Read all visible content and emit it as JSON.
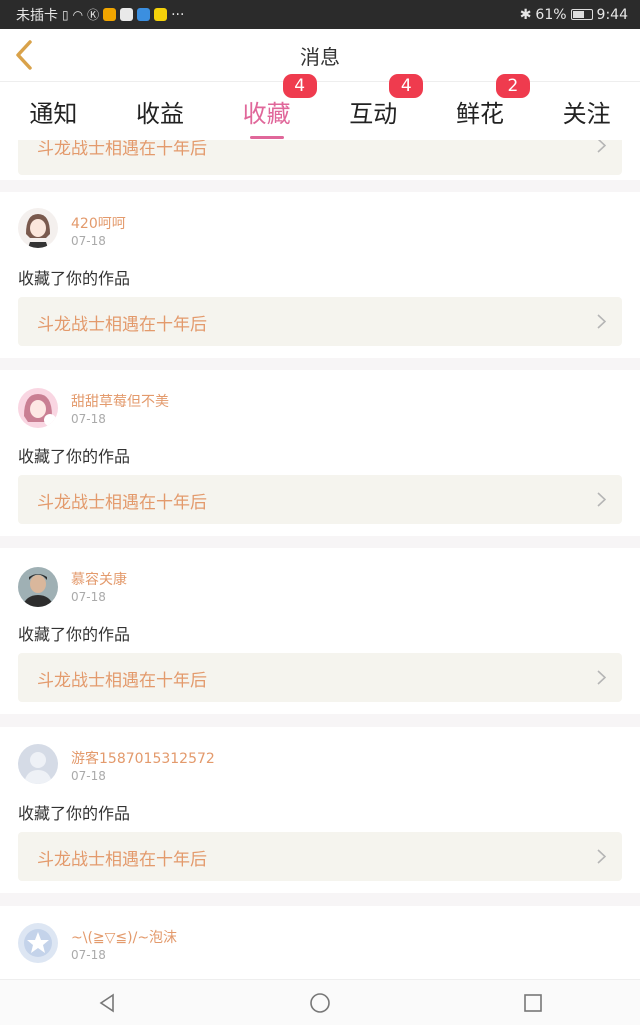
{
  "status_bar": {
    "carrier": "未插卡",
    "more": "···",
    "battery": "61%",
    "time": "9:44"
  },
  "nav": {
    "back_icon": "chevron-left-icon",
    "title": "消息"
  },
  "tabs": [
    {
      "label": "通知",
      "badge": ""
    },
    {
      "label": "收益",
      "badge": ""
    },
    {
      "label": "收藏",
      "badge": "4"
    },
    {
      "label": "互动",
      "badge": "4"
    },
    {
      "label": "鲜花",
      "badge": "2"
    },
    {
      "label": "关注",
      "badge": ""
    }
  ],
  "active_tab": "收藏",
  "partial_top_card": {
    "work_title": "斗龙战士相遇在十年后"
  },
  "messages": [
    {
      "username": "420呵呵",
      "date": "07-18",
      "action": "收藏了你的作品",
      "work_title": "斗龙战士相遇在十年后",
      "avatar": "anime-girl-avatar"
    },
    {
      "username": "甜甜草莓但不美",
      "date": "07-18",
      "action": "收藏了你的作品",
      "work_title": "斗龙战士相遇在十年后",
      "avatar": "pink-anime-avatar"
    },
    {
      "username": "慕容关康",
      "date": "07-18",
      "action": "收藏了你的作品",
      "work_title": "斗龙战士相遇在十年后",
      "avatar": "photo-avatar"
    },
    {
      "username": "游客1587015312572",
      "date": "07-18",
      "action": "收藏了你的作品",
      "work_title": "斗龙战士相遇在十年后",
      "avatar": "default-person-avatar"
    },
    {
      "username": "~\\(≧▽≦)/~泡沫",
      "date": "07-18",
      "action": "",
      "work_title": "",
      "avatar": "star-badge-avatar"
    }
  ],
  "colors": {
    "accent_pink": "#e0679a",
    "badge_red": "#ef3b4e",
    "link_orange": "#e39a6c",
    "link_bg": "#f5f4ee"
  }
}
